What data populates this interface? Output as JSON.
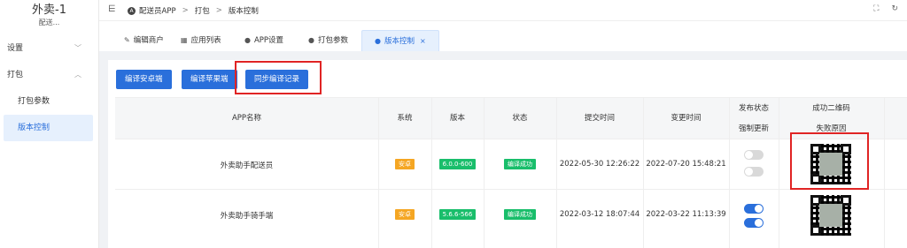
{
  "sidebar": {
    "brand_title": "外卖-1",
    "brand_sub": "配送...",
    "items": [
      {
        "label": "设置",
        "chevron": "﹀"
      },
      {
        "label": "打包",
        "chevron": "︿"
      },
      {
        "label": "打包参数"
      },
      {
        "label": "版本控制"
      }
    ]
  },
  "topbar": {
    "fold_icon": "⋿",
    "breadcrumb": [
      "配送员APP",
      "打包",
      "版本控制"
    ],
    "sep": ">"
  },
  "tabs": [
    {
      "label": "编辑商户",
      "icon": "edit-icon"
    },
    {
      "label": "应用列表",
      "icon": "grid-icon"
    },
    {
      "label": "APP设置",
      "icon": "app-icon"
    },
    {
      "label": "打包参数",
      "icon": "app-icon"
    },
    {
      "label": "版本控制",
      "icon": "app-icon",
      "active": true
    }
  ],
  "toolbar": {
    "btn_android": "编译安卓端",
    "btn_ios": "编译苹果端",
    "btn_sync": "同步编译记录"
  },
  "table": {
    "headers": {
      "app_name": "APP名称",
      "system": "系统",
      "version": "版本",
      "status": "状态",
      "submit_time": "提交时间",
      "change_time": "变更时间",
      "publish_status": "发布状态",
      "force_update": "强制更新",
      "qr": "成功二维码",
      "fail_reason": "失败原因"
    },
    "rows": [
      {
        "app_name": "外卖助手配送员",
        "system": "安卓",
        "version": "6.0.0-600",
        "status": "编译成功",
        "submit_time": "2022-05-30 12:26:22",
        "change_time": "2022-07-20 15:48:21",
        "publish_on": false,
        "force_on": false
      },
      {
        "app_name": "外卖助手骑手端",
        "system": "安卓",
        "version": "5.6.6-566",
        "status": "编译成功",
        "submit_time": "2022-03-12 18:07:44",
        "change_time": "2022-03-22 11:13:39",
        "publish_on": true,
        "force_on": true
      }
    ]
  },
  "colors": {
    "primary": "#2a6fdb",
    "highlight": "#e02424",
    "tag_orange": "#f5a623",
    "tag_green": "#19be6b"
  }
}
